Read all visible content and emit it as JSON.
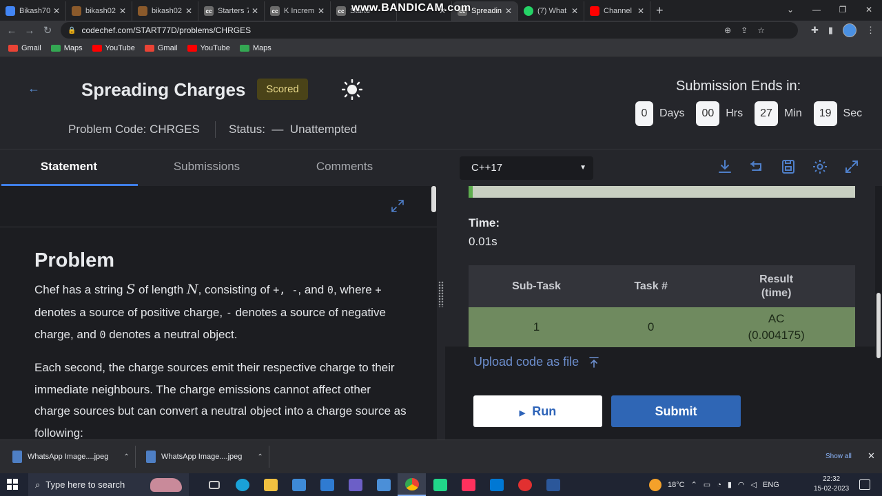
{
  "browser": {
    "tabs": [
      {
        "title": "Bikash70",
        "favicon": "bar-chart",
        "color": "#4285f4"
      },
      {
        "title": "bikash02",
        "favicon": "codechef",
        "color": "#8b5a2b"
      },
      {
        "title": "bikash02",
        "favicon": "codechef",
        "color": "#8b5a2b"
      },
      {
        "title": "Starters 7",
        "favicon": "cc",
        "color": "#6b6b6b"
      },
      {
        "title": "K Increm",
        "favicon": "cc",
        "color": "#6b6b6b"
      },
      {
        "title": "Starte",
        "favicon": "cc",
        "color": "#6b6b6b"
      },
      {
        "title": "",
        "favicon": "cc",
        "color": "#6b6b6b"
      },
      {
        "title": "Spreadin",
        "favicon": "cc",
        "color": "#6b6b6b",
        "active": true
      },
      {
        "title": "(7) What",
        "favicon": "whatsapp",
        "color": "#25d366"
      },
      {
        "title": "Channel",
        "favicon": "youtube",
        "color": "#ff0000"
      }
    ],
    "watermark": "www.BANDICAM.com",
    "url": "codechef.com/START77D/problems/CHRGES",
    "bookmarks": [
      {
        "label": "Gmail",
        "icon": "gmail-icon",
        "color": "#ea4335"
      },
      {
        "label": "Maps",
        "icon": "maps-icon",
        "color": "#34a853"
      },
      {
        "label": "YouTube",
        "icon": "youtube-icon",
        "color": "#ff0000"
      },
      {
        "label": "Gmail",
        "icon": "gmail-icon",
        "color": "#ea4335"
      },
      {
        "label": "YouTube",
        "icon": "youtube-icon",
        "color": "#ff0000"
      },
      {
        "label": "Maps",
        "icon": "maps-icon",
        "color": "#34a853"
      }
    ]
  },
  "problem": {
    "title": "Spreading Charges",
    "badge": "Scored",
    "code_label": "Problem Code: CHRGES",
    "status_label": "Status:  —  Unattempted"
  },
  "timer": {
    "heading": "Submission Ends in:",
    "days": "0",
    "days_label": "Days",
    "hrs": "00",
    "hrs_label": "Hrs",
    "min": "27",
    "min_label": "Min",
    "sec": "19",
    "sec_label": "Sec"
  },
  "tabs": {
    "statement": "Statement",
    "submissions": "Submissions",
    "comments": "Comments"
  },
  "editor": {
    "language": "C++17"
  },
  "statement": {
    "heading": "Problem",
    "p1_a": "Chef has a string ",
    "p1_S": "S",
    "p1_b": " of length ",
    "p1_N": "N",
    "p1_c": ", consisting of ",
    "p1_plus": "+",
    "p1_comma1": ", ",
    "p1_minus": "-",
    "p1_and": ", and ",
    "p1_zero": "0",
    "p1_d": ", where ",
    "p1_plus2": "+",
    "p1_e": " denotes a source of positive charge, ",
    "p1_minus2": "-",
    "p1_f": " denotes a source of negative charge, and ",
    "p1_zero2": "0",
    "p1_g": " denotes a neutral object.",
    "p2": "Each second, the charge sources emit their respective charge to their immediate neighbours. The charge emissions cannot affect other charge sources but can convert a neutral object into a charge source as following:"
  },
  "result": {
    "time_label": "Time:",
    "time_value": "0.01s",
    "headers": [
      "Sub-Task",
      "Task #",
      "Result\n(time)"
    ],
    "rows": [
      {
        "subtask": "1",
        "task": "0",
        "result": "AC",
        "time": "(0.004175)"
      }
    ],
    "upload_label": "Upload code as file",
    "run_label": "Run",
    "submit_label": "Submit"
  },
  "downloads": {
    "items": [
      "WhatsApp Image....jpeg",
      "WhatsApp Image....jpeg"
    ],
    "show_all": "Show all"
  },
  "taskbar": {
    "search_placeholder": "Type here to search",
    "temperature": "18°C",
    "language": "ENG",
    "time": "22:32",
    "date": "15-02-2023"
  },
  "colors": {
    "accent": "#3f7ee8",
    "submit": "#2f66b5",
    "ac_row": "#6f8a5f",
    "scored_bg": "#4a4318"
  }
}
